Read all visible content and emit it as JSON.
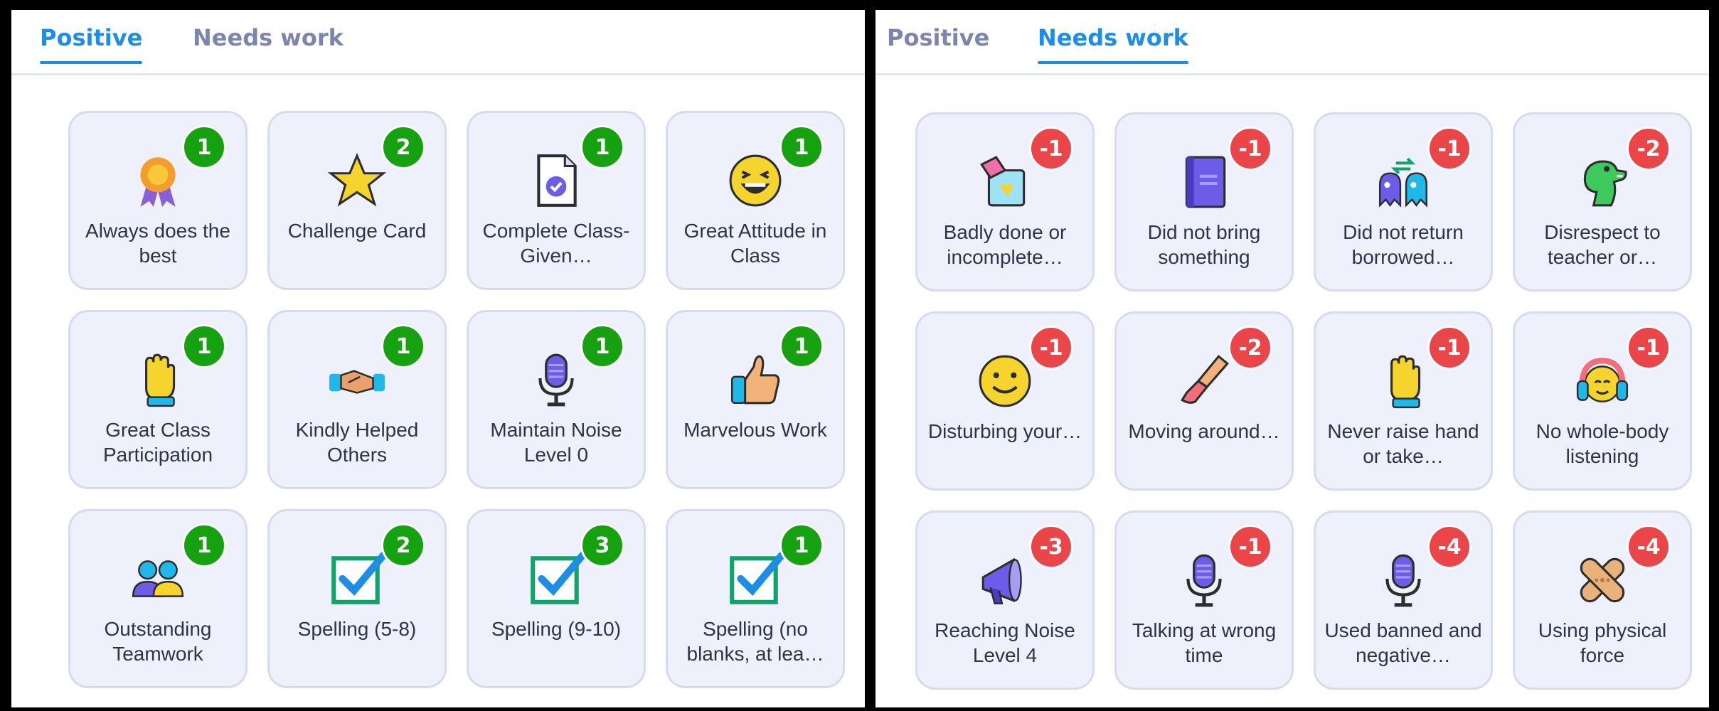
{
  "left_panel": {
    "tabs": {
      "positive": "Positive",
      "needs_work": "Needs work"
    },
    "cards": [
      {
        "label": "Always does the best",
        "points": "1",
        "icon": "ribbon-award-icon"
      },
      {
        "label": "Challenge Card",
        "points": "2",
        "icon": "star-icon"
      },
      {
        "label": "Complete Class-Given…",
        "points": "1",
        "icon": "document-check-icon"
      },
      {
        "label": "Great Attitude in Class",
        "points": "1",
        "icon": "laughing-face-icon"
      },
      {
        "label": "Great Class Participation",
        "points": "1",
        "icon": "raised-hand-icon"
      },
      {
        "label": "Kindly Helped Others",
        "points": "1",
        "icon": "handshake-icon"
      },
      {
        "label": "Maintain Noise Level 0",
        "points": "1",
        "icon": "microphone-icon"
      },
      {
        "label": "Marvelous Work",
        "points": "1",
        "icon": "thumbs-up-icon"
      },
      {
        "label": "Outstanding Teamwork",
        "points": "1",
        "icon": "team-people-icon"
      },
      {
        "label": "Spelling (5-8)",
        "points": "2",
        "icon": "checkbox-icon"
      },
      {
        "label": "Spelling (9-10)",
        "points": "3",
        "icon": "checkbox-icon"
      },
      {
        "label": "Spelling (no blanks, at lea…",
        "points": "1",
        "icon": "checkbox-icon"
      }
    ]
  },
  "right_panel": {
    "tabs": {
      "positive": "Positive",
      "needs_work": "Needs work"
    },
    "cards": [
      {
        "label": "Badly done or incomplete…",
        "points": "-1",
        "icon": "broken-paper-icon"
      },
      {
        "label": "Did not bring something",
        "points": "-1",
        "icon": "book-icon"
      },
      {
        "label": "Did not return borrowed…",
        "points": "-1",
        "icon": "exchange-monsters-icon"
      },
      {
        "label": "Disrespect to teacher or…",
        "points": "-2",
        "icon": "dinosaur-icon"
      },
      {
        "label": "Disturbing your…",
        "points": "-1",
        "icon": "smiley-face-icon"
      },
      {
        "label": "Moving around…",
        "points": "-2",
        "icon": "leg-kick-icon"
      },
      {
        "label": "Never raise hand or take…",
        "points": "-1",
        "icon": "raised-hand-icon"
      },
      {
        "label": "No whole-body listening",
        "points": "-1",
        "icon": "headphones-face-icon"
      },
      {
        "label": "Reaching Noise Level 4",
        "points": "-3",
        "icon": "megaphone-icon"
      },
      {
        "label": "Talking at wrong time",
        "points": "-1",
        "icon": "microphone-icon"
      },
      {
        "label": "Used banned and negative…",
        "points": "-4",
        "icon": "microphone-icon"
      },
      {
        "label": "Using physical force",
        "points": "-4",
        "icon": "bandage-cross-icon"
      }
    ]
  },
  "colors": {
    "active_tab": "#1c8ee6",
    "inactive_tab": "#7c85ad",
    "positive_badge": "#16a210",
    "negative_badge": "#ea4549",
    "card_bg": "#eef1fb"
  }
}
